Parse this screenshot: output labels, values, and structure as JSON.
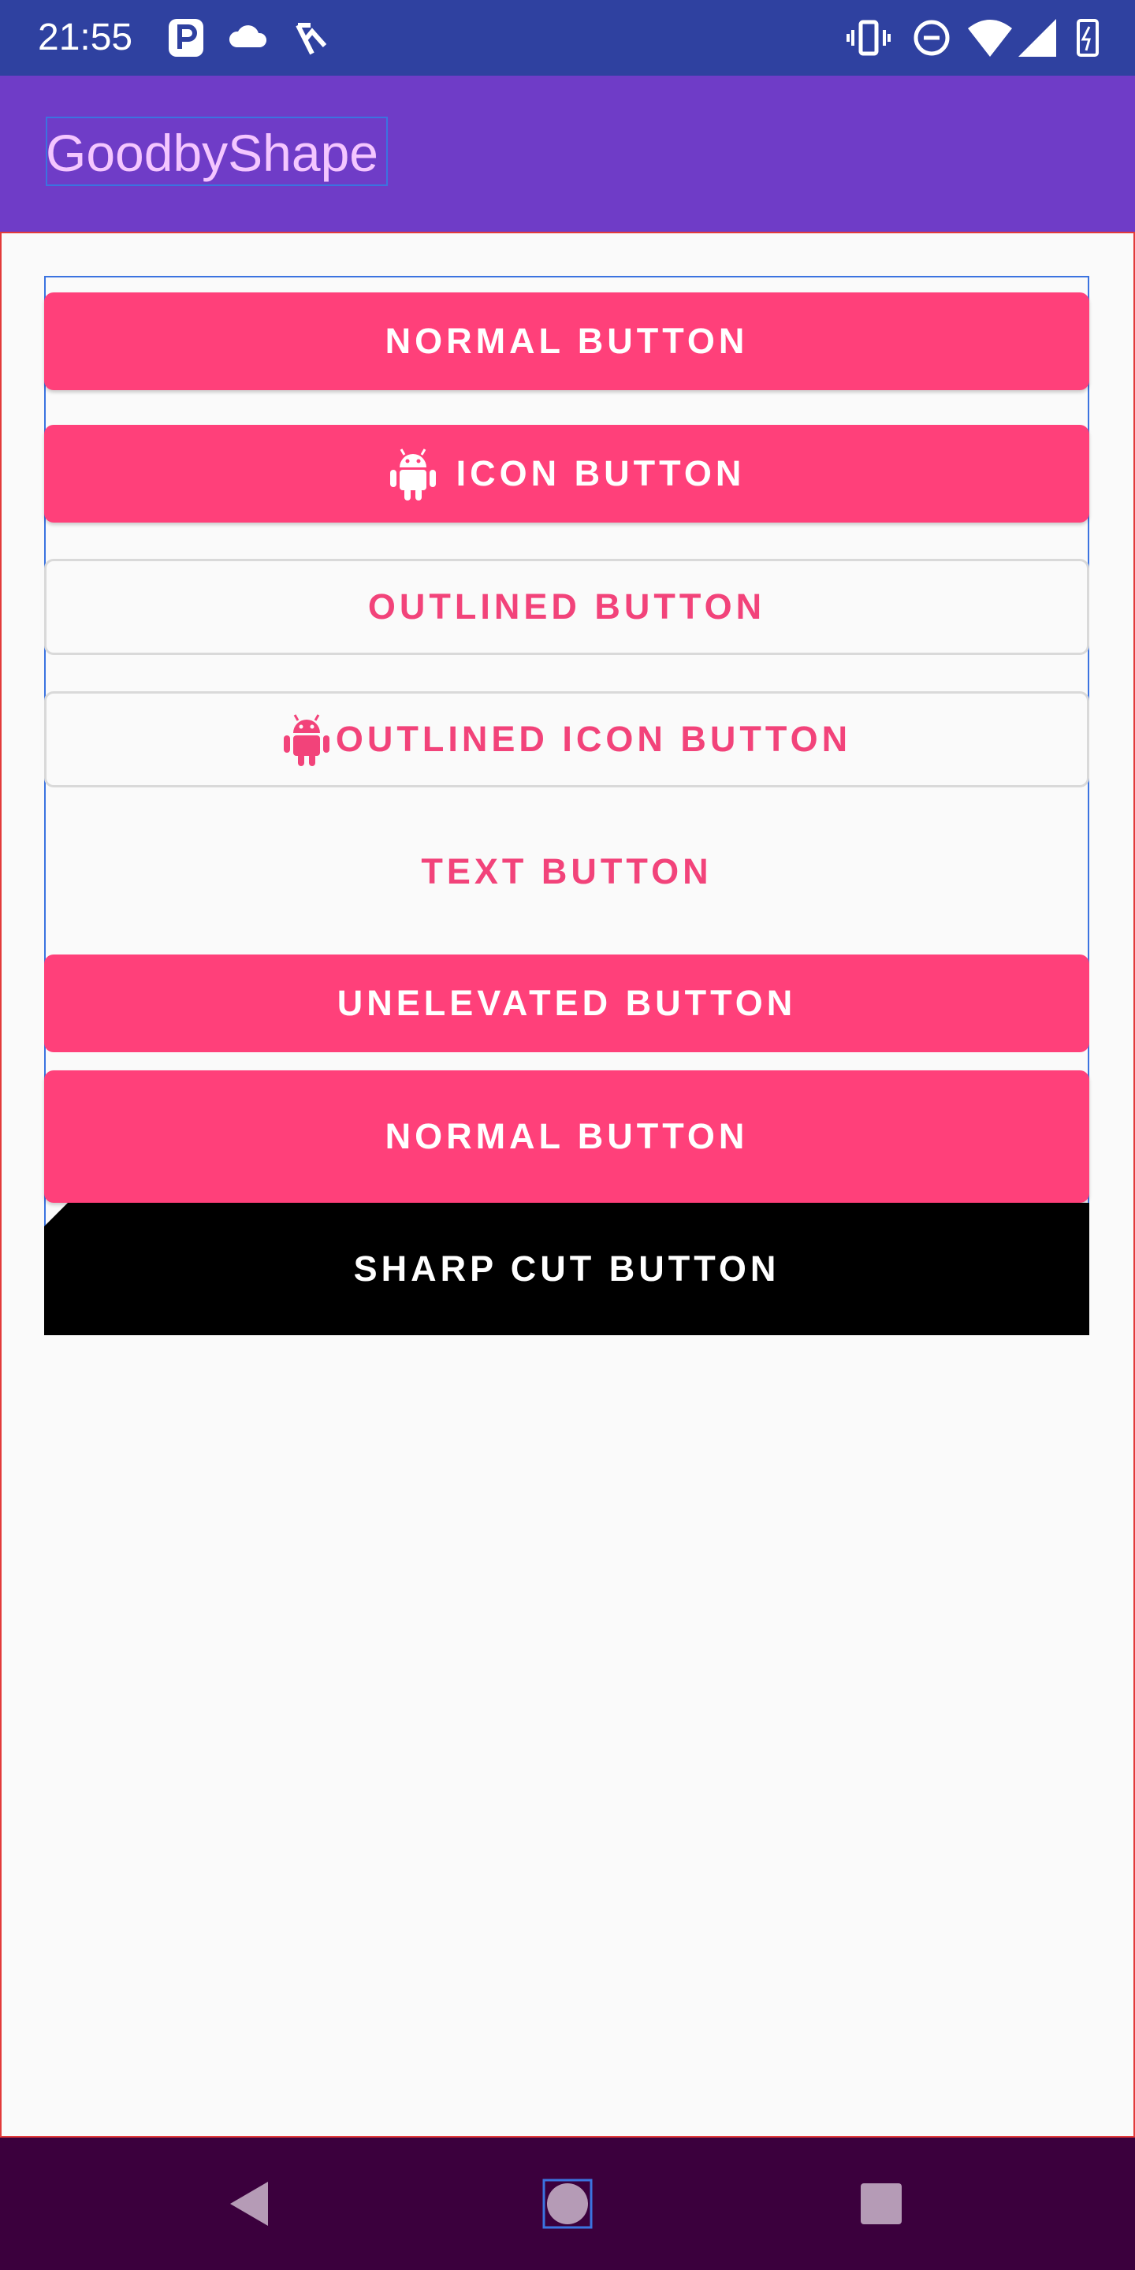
{
  "status_bar": {
    "time": "21:55",
    "left_icons": [
      "parking-icon",
      "cloud-icon",
      "tasks-check-icon"
    ],
    "right_icons": [
      "vibrate-icon",
      "do-not-disturb-icon",
      "wifi-icon",
      "signal-icon",
      "battery-charging-icon"
    ]
  },
  "app_bar": {
    "title": "GoodbyShape"
  },
  "buttons": [
    {
      "label": "NORMAL BUTTON",
      "style": "filled"
    },
    {
      "label": "ICON BUTTON",
      "style": "filled",
      "icon": "android-icon"
    },
    {
      "label": "OUTLINED BUTTON",
      "style": "outlined"
    },
    {
      "label": "OUTLINED ICON BUTTON",
      "style": "outlined",
      "icon": "android-icon"
    },
    {
      "label": "TEXT BUTTON",
      "style": "text"
    },
    {
      "label": "UNELEVATED BUTTON",
      "style": "filled"
    },
    {
      "label": "NORMAL BUTTON",
      "style": "filled"
    },
    {
      "label": "SHARP CUT BUTTON",
      "style": "sharp"
    }
  ],
  "nav_bar": {
    "items": [
      "back-icon",
      "home-icon",
      "recents-icon"
    ]
  },
  "colors": {
    "status_bar": "#2f41a0",
    "app_bar": "#6f3cc7",
    "accent": "#ff407a",
    "nav_bar": "#3b003d",
    "title_text": "#f4c6ff"
  }
}
